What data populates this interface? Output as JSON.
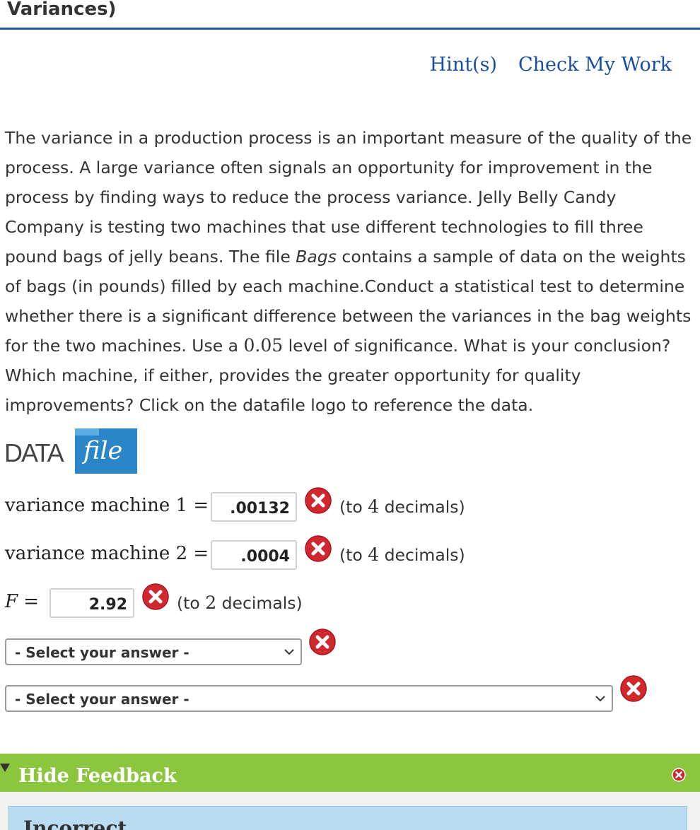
{
  "title": "Variances)",
  "links": {
    "hint": "Hint(s)",
    "check": "Check My Work"
  },
  "question": {
    "p1": "The variance in a production process is an important measure of the quality of the process. A large variance often signals an opportunity for improvement in the process by finding ways to reduce the process variance. Jelly Belly Candy Company is testing two machines that use different technologies to fill three pound bags of jelly beans. The file ",
    "file_name": "Bags",
    "p2": " contains a sample of data on the weights of bags (in pounds) filled by each machine.Conduct a statistical test to determine whether there is a significant difference between the variances in the bag weights for the two machines. Use a ",
    "alpha": "0.05",
    "p3": " level of significance. What is your conclusion? Which machine, if either, provides the greater opportunity for quality improvements? Click on the datafile logo to reference the data."
  },
  "datafile": {
    "part1": "DATA",
    "part2": "file"
  },
  "answers": {
    "var1": {
      "label": "variance machine 1 =",
      "value": ".00132",
      "dec_prefix": "(to ",
      "dec_num": "4",
      "dec_suffix": " decimals)"
    },
    "var2": {
      "label": "variance machine 2 =",
      "value": ".0004",
      "dec_prefix": "(to ",
      "dec_num": "4",
      "dec_suffix": " decimals)"
    },
    "f": {
      "label": "F =",
      "value": "2.92",
      "dec_prefix": "(to ",
      "dec_num": "2",
      "dec_suffix": " decimals)"
    }
  },
  "selects": {
    "s1": "- Select your answer -",
    "s2": "- Select your answer -"
  },
  "feedback": {
    "toggle": "Hide Feedback",
    "status": "Incorrect"
  },
  "colors": {
    "link": "#1a4fa0",
    "error": "#d0282e",
    "feedback_bar": "#8cc63f",
    "feedback_panel": "#b9dcf0"
  }
}
